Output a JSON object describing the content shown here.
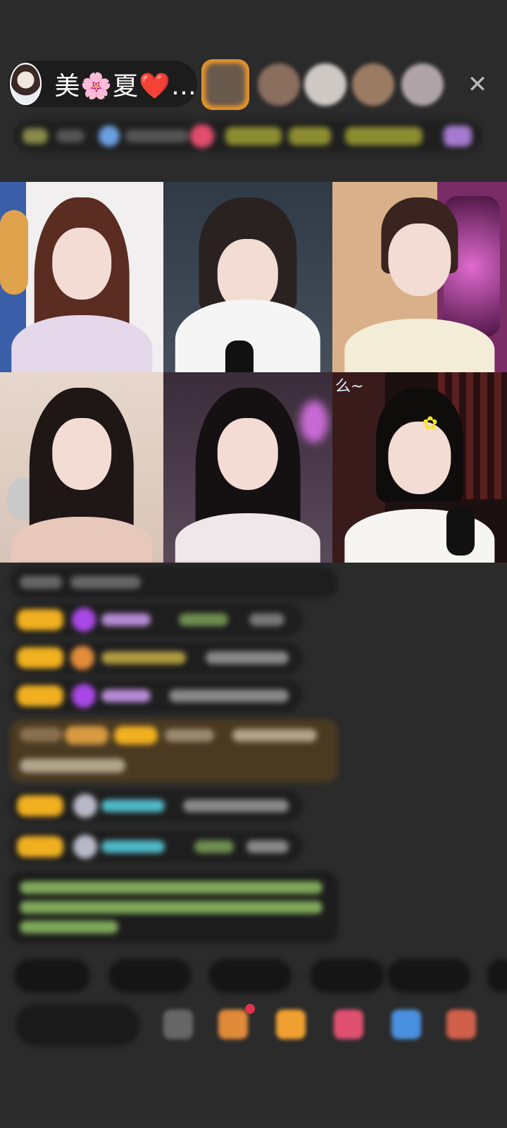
{
  "header": {
    "host_name": "美🌸夏❤️…",
    "close_label": "✕"
  },
  "grid": {
    "tiles": [
      {
        "caption": ""
      },
      {
        "caption": ""
      },
      {
        "caption": ""
      },
      {
        "caption": ""
      },
      {
        "caption": ""
      },
      {
        "caption": "么~",
        "flower": "✿"
      }
    ]
  },
  "colors": {
    "background": "#2b2b2b",
    "badge_yellow": "#f0b020",
    "chat_name_purple": "#b58bd6",
    "chat_name_cyan": "#4fb7c6",
    "announcement_green": "#9ac86a"
  }
}
